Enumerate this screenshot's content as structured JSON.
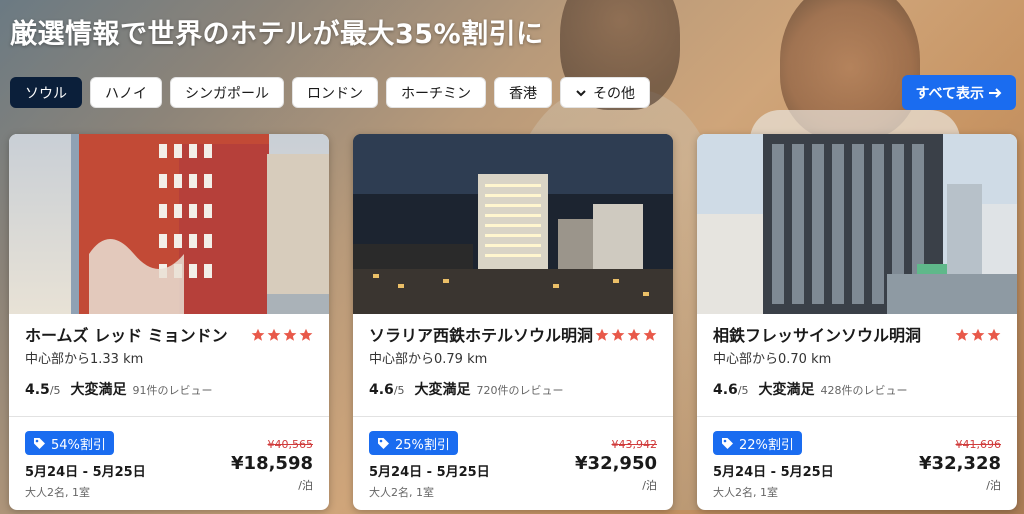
{
  "headline": "厳選情報で世界のホテルが最大35%割引に",
  "filters": {
    "chips": [
      {
        "label": "ソウル",
        "active": true
      },
      {
        "label": "ハノイ",
        "active": false
      },
      {
        "label": "シンガポール",
        "active": false
      },
      {
        "label": "ロンドン",
        "active": false
      },
      {
        "label": "ホーチミン",
        "active": false
      },
      {
        "label": "香港",
        "active": false
      }
    ],
    "more_label": "その他",
    "show_all_label": "すべて表示"
  },
  "cards": [
    {
      "name": "ホームズ レッド ミョンドン",
      "stars": 4,
      "distance": "中心部から1.33 km",
      "score": "4.5",
      "score_den": "/5",
      "rating_label": "大変満足",
      "reviews": "91件のレビュー",
      "discount": "54%割引",
      "dates": "5月24日 - 5月25日",
      "guests": "大人2名, 1室",
      "original_price": "¥40,565",
      "price": "¥18,598",
      "per_night": "/泊"
    },
    {
      "name": "ソラリア西鉄ホテルソウル明洞",
      "stars": 4,
      "distance": "中心部から0.79 km",
      "score": "4.6",
      "score_den": "/5",
      "rating_label": "大変満足",
      "reviews": "720件のレビュー",
      "discount": "25%割引",
      "dates": "5月24日 - 5月25日",
      "guests": "大人2名, 1室",
      "original_price": "¥43,942",
      "price": "¥32,950",
      "per_night": "/泊"
    },
    {
      "name": "相鉄フレッサインソウル明洞",
      "stars": 3,
      "distance": "中心部から0.70 km",
      "score": "4.6",
      "score_den": "/5",
      "rating_label": "大変満足",
      "reviews": "428件のレビュー",
      "discount": "22%割引",
      "dates": "5月24日 - 5月25日",
      "guests": "大人2名, 1室",
      "original_price": "¥41,696",
      "price": "¥32,328",
      "per_night": "/泊"
    }
  ],
  "colors": {
    "accent": "#1a6cf0",
    "active_chip": "#0b1f3a",
    "star": "#e8594a",
    "strike_price": "#d03b3b"
  }
}
